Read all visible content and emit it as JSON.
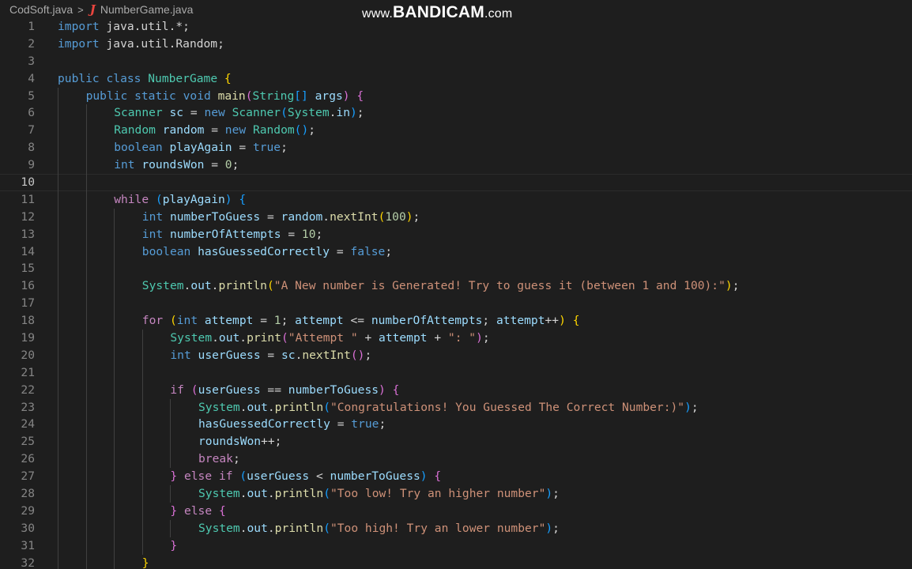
{
  "breadcrumb": {
    "folder": "CodSoft.java",
    "separator": ">",
    "file_icon": "java-icon",
    "file_icon_glyph": "J",
    "file": "NumberGame.java"
  },
  "watermark": {
    "prefix": "www.",
    "brand": "BANDICAM",
    "suffix": ".com"
  },
  "editor": {
    "current_line": 10,
    "colors": {
      "background": "#1e1e1e",
      "keyword": "#569cd6",
      "control": "#c586c0",
      "type": "#4ec9b0",
      "variable": "#9cdcfe",
      "function": "#dcdcaa",
      "string": "#ce9178",
      "number": "#b5cea8",
      "java_icon": "#e9453e"
    },
    "lines": [
      {
        "n": "1",
        "indent": 0,
        "tokens": [
          [
            "import",
            "kw"
          ],
          [
            " java.util.*;",
            "plain"
          ]
        ]
      },
      {
        "n": "2",
        "indent": 0,
        "tokens": [
          [
            "import",
            "kw"
          ],
          [
            " java.util.Random;",
            "plain"
          ]
        ]
      },
      {
        "n": "3",
        "indent": 0,
        "tokens": []
      },
      {
        "n": "4",
        "indent": 0,
        "tokens": [
          [
            "public",
            "kw"
          ],
          [
            " ",
            "plain"
          ],
          [
            "class",
            "kw"
          ],
          [
            " ",
            "plain"
          ],
          [
            "NumberGame",
            "type"
          ],
          [
            " ",
            "plain"
          ],
          [
            "{",
            "b1"
          ]
        ]
      },
      {
        "n": "5",
        "indent": 1,
        "tokens": [
          [
            "public",
            "kw"
          ],
          [
            " ",
            "plain"
          ],
          [
            "static",
            "kw"
          ],
          [
            " ",
            "plain"
          ],
          [
            "void",
            "kw"
          ],
          [
            " ",
            "plain"
          ],
          [
            "main",
            "fn"
          ],
          [
            "(",
            "b2"
          ],
          [
            "String",
            "type"
          ],
          [
            "[]",
            "b3"
          ],
          [
            " ",
            "plain"
          ],
          [
            "args",
            "var"
          ],
          [
            ")",
            "b2"
          ],
          [
            " ",
            "plain"
          ],
          [
            "{",
            "b2"
          ]
        ]
      },
      {
        "n": "6",
        "indent": 2,
        "tokens": [
          [
            "Scanner",
            "type"
          ],
          [
            " ",
            "plain"
          ],
          [
            "sc",
            "var"
          ],
          [
            " = ",
            "plain"
          ],
          [
            "new",
            "kw"
          ],
          [
            " ",
            "plain"
          ],
          [
            "Scanner",
            "type"
          ],
          [
            "(",
            "b3"
          ],
          [
            "System",
            "type"
          ],
          [
            ".",
            "plain"
          ],
          [
            "in",
            "var"
          ],
          [
            ")",
            "b3"
          ],
          [
            ";",
            "plain"
          ]
        ]
      },
      {
        "n": "7",
        "indent": 2,
        "tokens": [
          [
            "Random",
            "type"
          ],
          [
            " ",
            "plain"
          ],
          [
            "random",
            "var"
          ],
          [
            " = ",
            "plain"
          ],
          [
            "new",
            "kw"
          ],
          [
            " ",
            "plain"
          ],
          [
            "Random",
            "type"
          ],
          [
            "()",
            "b3"
          ],
          [
            ";",
            "plain"
          ]
        ]
      },
      {
        "n": "8",
        "indent": 2,
        "tokens": [
          [
            "boolean",
            "kw"
          ],
          [
            " ",
            "plain"
          ],
          [
            "playAgain",
            "var"
          ],
          [
            " = ",
            "plain"
          ],
          [
            "true",
            "kw"
          ],
          [
            ";",
            "plain"
          ]
        ]
      },
      {
        "n": "9",
        "indent": 2,
        "tokens": [
          [
            "int",
            "kw"
          ],
          [
            " ",
            "plain"
          ],
          [
            "roundsWon",
            "var"
          ],
          [
            " = ",
            "plain"
          ],
          [
            "0",
            "num"
          ],
          [
            ";",
            "plain"
          ]
        ]
      },
      {
        "n": "10",
        "indent": 2,
        "tokens": []
      },
      {
        "n": "11",
        "indent": 2,
        "tokens": [
          [
            "while",
            "ctrl"
          ],
          [
            " ",
            "plain"
          ],
          [
            "(",
            "b3"
          ],
          [
            "playAgain",
            "var"
          ],
          [
            ")",
            "b3"
          ],
          [
            " ",
            "plain"
          ],
          [
            "{",
            "b3"
          ]
        ]
      },
      {
        "n": "12",
        "indent": 3,
        "tokens": [
          [
            "int",
            "kw"
          ],
          [
            " ",
            "plain"
          ],
          [
            "numberToGuess",
            "var"
          ],
          [
            " = ",
            "plain"
          ],
          [
            "random",
            "var"
          ],
          [
            ".",
            "plain"
          ],
          [
            "nextInt",
            "fn"
          ],
          [
            "(",
            "b1"
          ],
          [
            "100",
            "num"
          ],
          [
            ")",
            "b1"
          ],
          [
            ";",
            "plain"
          ]
        ]
      },
      {
        "n": "13",
        "indent": 3,
        "tokens": [
          [
            "int",
            "kw"
          ],
          [
            " ",
            "plain"
          ],
          [
            "numberOfAttempts",
            "var"
          ],
          [
            " = ",
            "plain"
          ],
          [
            "10",
            "num"
          ],
          [
            ";",
            "plain"
          ]
        ]
      },
      {
        "n": "14",
        "indent": 3,
        "tokens": [
          [
            "boolean",
            "kw"
          ],
          [
            " ",
            "plain"
          ],
          [
            "hasGuessedCorrectly",
            "var"
          ],
          [
            " = ",
            "plain"
          ],
          [
            "false",
            "kw"
          ],
          [
            ";",
            "plain"
          ]
        ]
      },
      {
        "n": "15",
        "indent": 3,
        "tokens": []
      },
      {
        "n": "16",
        "indent": 3,
        "tokens": [
          [
            "System",
            "type"
          ],
          [
            ".",
            "plain"
          ],
          [
            "out",
            "var"
          ],
          [
            ".",
            "plain"
          ],
          [
            "println",
            "fn"
          ],
          [
            "(",
            "b1"
          ],
          [
            "\"A New number is Generated! Try to guess it (between 1 and 100):\"",
            "str"
          ],
          [
            ")",
            "b1"
          ],
          [
            ";",
            "plain"
          ]
        ]
      },
      {
        "n": "17",
        "indent": 3,
        "tokens": []
      },
      {
        "n": "18",
        "indent": 3,
        "tokens": [
          [
            "for",
            "ctrl"
          ],
          [
            " ",
            "plain"
          ],
          [
            "(",
            "b1"
          ],
          [
            "int",
            "kw"
          ],
          [
            " ",
            "plain"
          ],
          [
            "attempt",
            "var"
          ],
          [
            " = ",
            "plain"
          ],
          [
            "1",
            "num"
          ],
          [
            "; ",
            "plain"
          ],
          [
            "attempt",
            "var"
          ],
          [
            " <= ",
            "plain"
          ],
          [
            "numberOfAttempts",
            "var"
          ],
          [
            "; ",
            "plain"
          ],
          [
            "attempt",
            "var"
          ],
          [
            "++",
            "plain"
          ],
          [
            ")",
            "b1"
          ],
          [
            " ",
            "plain"
          ],
          [
            "{",
            "b1"
          ]
        ]
      },
      {
        "n": "19",
        "indent": 4,
        "tokens": [
          [
            "System",
            "type"
          ],
          [
            ".",
            "plain"
          ],
          [
            "out",
            "var"
          ],
          [
            ".",
            "plain"
          ],
          [
            "print",
            "fn"
          ],
          [
            "(",
            "b2"
          ],
          [
            "\"Attempt \"",
            "str"
          ],
          [
            " + ",
            "plain"
          ],
          [
            "attempt",
            "var"
          ],
          [
            " + ",
            "plain"
          ],
          [
            "\": \"",
            "str"
          ],
          [
            ")",
            "b2"
          ],
          [
            ";",
            "plain"
          ]
        ]
      },
      {
        "n": "20",
        "indent": 4,
        "tokens": [
          [
            "int",
            "kw"
          ],
          [
            " ",
            "plain"
          ],
          [
            "userGuess",
            "var"
          ],
          [
            " = ",
            "plain"
          ],
          [
            "sc",
            "var"
          ],
          [
            ".",
            "plain"
          ],
          [
            "nextInt",
            "fn"
          ],
          [
            "()",
            "b2"
          ],
          [
            ";",
            "plain"
          ]
        ]
      },
      {
        "n": "21",
        "indent": 4,
        "tokens": []
      },
      {
        "n": "22",
        "indent": 4,
        "tokens": [
          [
            "if",
            "ctrl"
          ],
          [
            " ",
            "plain"
          ],
          [
            "(",
            "b2"
          ],
          [
            "userGuess",
            "var"
          ],
          [
            " == ",
            "plain"
          ],
          [
            "numberToGuess",
            "var"
          ],
          [
            ")",
            "b2"
          ],
          [
            " ",
            "plain"
          ],
          [
            "{",
            "b2"
          ]
        ]
      },
      {
        "n": "23",
        "indent": 5,
        "tokens": [
          [
            "System",
            "type"
          ],
          [
            ".",
            "plain"
          ],
          [
            "out",
            "var"
          ],
          [
            ".",
            "plain"
          ],
          [
            "println",
            "fn"
          ],
          [
            "(",
            "b3"
          ],
          [
            "\"Congratulations! You Guessed The Correct Number:)\"",
            "str"
          ],
          [
            ")",
            "b3"
          ],
          [
            ";",
            "plain"
          ]
        ]
      },
      {
        "n": "24",
        "indent": 5,
        "tokens": [
          [
            "hasGuessedCorrectly",
            "var"
          ],
          [
            " = ",
            "plain"
          ],
          [
            "true",
            "kw"
          ],
          [
            ";",
            "plain"
          ]
        ]
      },
      {
        "n": "25",
        "indent": 5,
        "tokens": [
          [
            "roundsWon",
            "var"
          ],
          [
            "++;",
            "plain"
          ]
        ]
      },
      {
        "n": "26",
        "indent": 5,
        "tokens": [
          [
            "break",
            "ctrl"
          ],
          [
            ";",
            "plain"
          ]
        ]
      },
      {
        "n": "27",
        "indent": 4,
        "tokens": [
          [
            "}",
            "b2"
          ],
          [
            " ",
            "plain"
          ],
          [
            "else",
            "ctrl"
          ],
          [
            " ",
            "plain"
          ],
          [
            "if",
            "ctrl"
          ],
          [
            " ",
            "plain"
          ],
          [
            "(",
            "b3"
          ],
          [
            "userGuess",
            "var"
          ],
          [
            " < ",
            "plain"
          ],
          [
            "numberToGuess",
            "var"
          ],
          [
            ")",
            "b3"
          ],
          [
            " ",
            "plain"
          ],
          [
            "{",
            "b2"
          ]
        ]
      },
      {
        "n": "28",
        "indent": 5,
        "tokens": [
          [
            "System",
            "type"
          ],
          [
            ".",
            "plain"
          ],
          [
            "out",
            "var"
          ],
          [
            ".",
            "plain"
          ],
          [
            "println",
            "fn"
          ],
          [
            "(",
            "b3"
          ],
          [
            "\"Too low! Try an higher number\"",
            "str"
          ],
          [
            ")",
            "b3"
          ],
          [
            ";",
            "plain"
          ]
        ]
      },
      {
        "n": "29",
        "indent": 4,
        "tokens": [
          [
            "}",
            "b2"
          ],
          [
            " ",
            "plain"
          ],
          [
            "else",
            "ctrl"
          ],
          [
            " ",
            "plain"
          ],
          [
            "{",
            "b2"
          ]
        ]
      },
      {
        "n": "30",
        "indent": 5,
        "tokens": [
          [
            "System",
            "type"
          ],
          [
            ".",
            "plain"
          ],
          [
            "out",
            "var"
          ],
          [
            ".",
            "plain"
          ],
          [
            "println",
            "fn"
          ],
          [
            "(",
            "b3"
          ],
          [
            "\"Too high! Try an lower number\"",
            "str"
          ],
          [
            ")",
            "b3"
          ],
          [
            ";",
            "plain"
          ]
        ]
      },
      {
        "n": "31",
        "indent": 4,
        "tokens": [
          [
            "}",
            "b2"
          ]
        ]
      },
      {
        "n": "32",
        "indent": 3,
        "tokens": [
          [
            "}",
            "b1"
          ]
        ]
      }
    ]
  }
}
